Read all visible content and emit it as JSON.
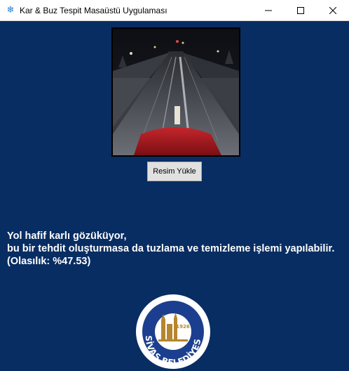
{
  "window": {
    "title": "Kar & Buz Tespit Masaüstü Uygulaması",
    "app_icon": "snowflake-icon",
    "controls": {
      "minimize": "minimize-icon",
      "maximize": "maximize-icon",
      "close": "close-icon"
    }
  },
  "image_panel": {
    "content": "night road camera view with snow, red vehicle hood in foreground"
  },
  "upload_button": {
    "label": "Resim Yükle"
  },
  "result": {
    "line1": "Yol hafif karlı gözüküyor,",
    "line2": "bu bir tehdit oluşturmasa da tuzlama ve temizleme işlemi yapılabilir.",
    "line3": "(Olasılık: %47.53)"
  },
  "logo": {
    "text": "SİVAS BELEDİYESİ",
    "year": "1926"
  },
  "colors": {
    "background": "#082d63",
    "logo_gold": "#b5852f",
    "logo_blue": "#1b3f8e"
  }
}
